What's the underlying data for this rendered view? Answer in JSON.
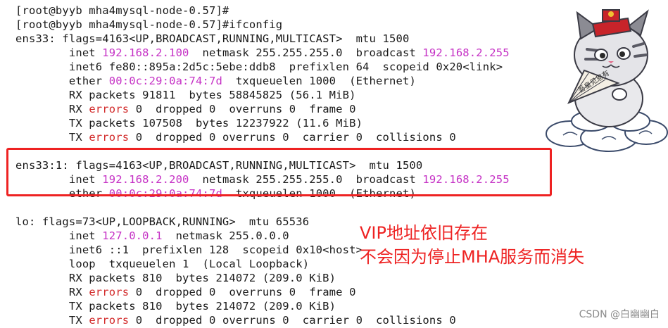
{
  "terminal": {
    "lines": [
      {
        "segments": [
          {
            "t": "[root@byyb mha4mysql-node-0.57]#",
            "c": "prompt"
          }
        ]
      },
      {
        "segments": [
          {
            "t": "[root@byyb mha4mysql-node-0.57]#ifconfig",
            "c": "prompt"
          }
        ]
      },
      {
        "segments": [
          {
            "t": "ens33: flags=4163<UP,BROADCAST,RUNNING,MULTICAST>  mtu 1500",
            "c": ""
          }
        ]
      },
      {
        "segments": [
          {
            "t": "        inet ",
            "c": ""
          },
          {
            "t": "192.168.2.100",
            "c": "hl"
          },
          {
            "t": "  netmask 255.255.255.0  broadcast ",
            "c": ""
          },
          {
            "t": "192.168.2.255",
            "c": "hl"
          }
        ]
      },
      {
        "segments": [
          {
            "t": "        inet6 fe80::895a:2d5c:5ebe:ddb8  prefixlen 64  scopeid 0x20<link>",
            "c": ""
          }
        ]
      },
      {
        "segments": [
          {
            "t": "        ether ",
            "c": ""
          },
          {
            "t": "00:0c:29:0a:74:7d",
            "c": "hl"
          },
          {
            "t": "  txqueuelen 1000  (Ethernet)",
            "c": ""
          }
        ]
      },
      {
        "segments": [
          {
            "t": "        RX packets 91811  bytes 58845825 (56.1 MiB)",
            "c": ""
          }
        ]
      },
      {
        "segments": [
          {
            "t": "        RX ",
            "c": ""
          },
          {
            "t": "errors",
            "c": "err"
          },
          {
            "t": " 0  dropped 0  overruns 0  frame 0",
            "c": ""
          }
        ]
      },
      {
        "segments": [
          {
            "t": "        TX packets 107508  bytes 12237922 (11.6 MiB)",
            "c": ""
          }
        ]
      },
      {
        "segments": [
          {
            "t": "        TX ",
            "c": ""
          },
          {
            "t": "errors",
            "c": "err"
          },
          {
            "t": " 0  dropped 0 overruns 0  carrier 0  collisions 0",
            "c": ""
          }
        ]
      },
      {
        "segments": [
          {
            "t": "",
            "c": ""
          }
        ]
      },
      {
        "segments": [
          {
            "t": "ens33:1: flags=4163<UP,BROADCAST,RUNNING,MULTICAST>  mtu 1500",
            "c": ""
          }
        ]
      },
      {
        "segments": [
          {
            "t": "        inet ",
            "c": ""
          },
          {
            "t": "192.168.2.200",
            "c": "hl"
          },
          {
            "t": "  netmask 255.255.255.0  broadcast ",
            "c": ""
          },
          {
            "t": "192.168.2.255",
            "c": "hl"
          }
        ]
      },
      {
        "segments": [
          {
            "t": "        ether ",
            "c": ""
          },
          {
            "t": "00:0c:29:0a:74:7d",
            "c": "hl"
          },
          {
            "t": "  txqueuelen 1000  (Ethernet)",
            "c": ""
          }
        ]
      },
      {
        "segments": [
          {
            "t": "",
            "c": ""
          }
        ]
      },
      {
        "segments": [
          {
            "t": "lo: flags=73<UP,LOOPBACK,RUNNING>  mtu 65536",
            "c": ""
          }
        ]
      },
      {
        "segments": [
          {
            "t": "        inet ",
            "c": ""
          },
          {
            "t": "127.0.0.1",
            "c": "hl"
          },
          {
            "t": "  netmask 255.0.0.0",
            "c": ""
          }
        ]
      },
      {
        "segments": [
          {
            "t": "        inet6 ::1  prefixlen 128  scopeid 0x10<host>",
            "c": ""
          }
        ]
      },
      {
        "segments": [
          {
            "t": "        loop  txqueuelen 1  (Local Loopback)",
            "c": ""
          }
        ]
      },
      {
        "segments": [
          {
            "t": "        RX packets 810  bytes 214072 (209.0 KiB)",
            "c": ""
          }
        ]
      },
      {
        "segments": [
          {
            "t": "        RX ",
            "c": ""
          },
          {
            "t": "errors",
            "c": "err"
          },
          {
            "t": " 0  dropped 0  overruns 0  frame 0",
            "c": ""
          }
        ]
      },
      {
        "segments": [
          {
            "t": "        TX packets 810  bytes 214072 (209.0 KiB)",
            "c": ""
          }
        ]
      },
      {
        "segments": [
          {
            "t": "        TX ",
            "c": ""
          },
          {
            "t": "errors",
            "c": "err"
          },
          {
            "t": " 0  dropped 0 overruns 0  carrier 0  collisions 0",
            "c": ""
          }
        ]
      }
    ]
  },
  "annotation": {
    "line1": "VIP地址依旧存在",
    "line2": "不会因为停止MHA服务而消失",
    "color": "#ee2222"
  },
  "sticker": {
    "icon": "lucky-cat-sticker-icon",
    "fan_text": "吾皇见恩有"
  },
  "watermark": "CSDN @白幽幽白",
  "colors": {
    "highlight": "#c531c5",
    "error": "#d22a2a",
    "box": "#ee2222"
  }
}
